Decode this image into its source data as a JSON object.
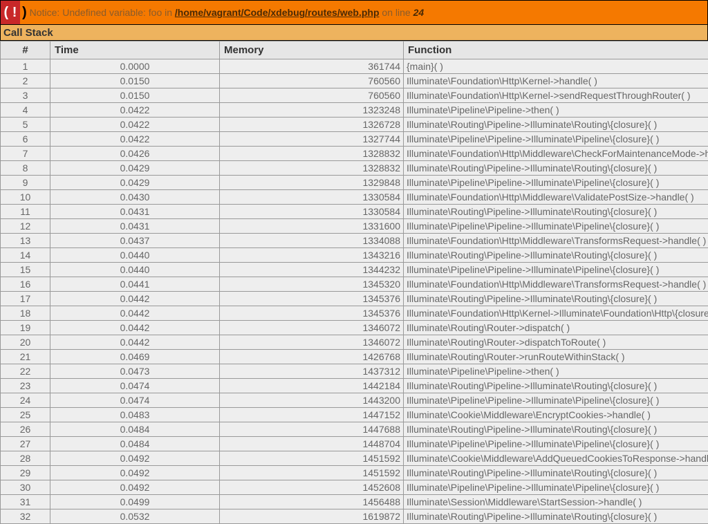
{
  "notice": {
    "label": "Notice:",
    "message": "Undefined variable: foo in",
    "file": "/home/vagrant/Code/xdebug/routes/web.php",
    "on_line_text": "on line",
    "line": "24"
  },
  "callstack": {
    "title": "Call Stack",
    "headers": {
      "num": "#",
      "time": "Time",
      "memory": "Memory",
      "function": "Function"
    },
    "rows": [
      {
        "num": "1",
        "time": "0.0000",
        "memory": "361744",
        "fn": "{main}( )"
      },
      {
        "num": "2",
        "time": "0.0150",
        "memory": "760560",
        "fn": "Illuminate\\Foundation\\Http\\Kernel->handle( )"
      },
      {
        "num": "3",
        "time": "0.0150",
        "memory": "760560",
        "fn": "Illuminate\\Foundation\\Http\\Kernel->sendRequestThroughRouter( )"
      },
      {
        "num": "4",
        "time": "0.0422",
        "memory": "1323248",
        "fn": "Illuminate\\Pipeline\\Pipeline->then( )"
      },
      {
        "num": "5",
        "time": "0.0422",
        "memory": "1326728",
        "fn": "Illuminate\\Routing\\Pipeline->Illuminate\\Routing\\{closure}( )"
      },
      {
        "num": "6",
        "time": "0.0422",
        "memory": "1327744",
        "fn": "Illuminate\\Pipeline\\Pipeline->Illuminate\\Pipeline\\{closure}( )"
      },
      {
        "num": "7",
        "time": "0.0426",
        "memory": "1328832",
        "fn": "Illuminate\\Foundation\\Http\\Middleware\\CheckForMaintenanceMode->handle( )"
      },
      {
        "num": "8",
        "time": "0.0429",
        "memory": "1328832",
        "fn": "Illuminate\\Routing\\Pipeline->Illuminate\\Routing\\{closure}( )"
      },
      {
        "num": "9",
        "time": "0.0429",
        "memory": "1329848",
        "fn": "Illuminate\\Pipeline\\Pipeline->Illuminate\\Pipeline\\{closure}( )"
      },
      {
        "num": "10",
        "time": "0.0430",
        "memory": "1330584",
        "fn": "Illuminate\\Foundation\\Http\\Middleware\\ValidatePostSize->handle( )"
      },
      {
        "num": "11",
        "time": "0.0431",
        "memory": "1330584",
        "fn": "Illuminate\\Routing\\Pipeline->Illuminate\\Routing\\{closure}( )"
      },
      {
        "num": "12",
        "time": "0.0431",
        "memory": "1331600",
        "fn": "Illuminate\\Pipeline\\Pipeline->Illuminate\\Pipeline\\{closure}( )"
      },
      {
        "num": "13",
        "time": "0.0437",
        "memory": "1334088",
        "fn": "Illuminate\\Foundation\\Http\\Middleware\\TransformsRequest->handle( )"
      },
      {
        "num": "14",
        "time": "0.0440",
        "memory": "1343216",
        "fn": "Illuminate\\Routing\\Pipeline->Illuminate\\Routing\\{closure}( )"
      },
      {
        "num": "15",
        "time": "0.0440",
        "memory": "1344232",
        "fn": "Illuminate\\Pipeline\\Pipeline->Illuminate\\Pipeline\\{closure}( )"
      },
      {
        "num": "16",
        "time": "0.0441",
        "memory": "1345320",
        "fn": "Illuminate\\Foundation\\Http\\Middleware\\TransformsRequest->handle( )"
      },
      {
        "num": "17",
        "time": "0.0442",
        "memory": "1345376",
        "fn": "Illuminate\\Routing\\Pipeline->Illuminate\\Routing\\{closure}( )"
      },
      {
        "num": "18",
        "time": "0.0442",
        "memory": "1345376",
        "fn": "Illuminate\\Foundation\\Http\\Kernel->Illuminate\\Foundation\\Http\\{closure}( )"
      },
      {
        "num": "19",
        "time": "0.0442",
        "memory": "1346072",
        "fn": "Illuminate\\Routing\\Router->dispatch( )"
      },
      {
        "num": "20",
        "time": "0.0442",
        "memory": "1346072",
        "fn": "Illuminate\\Routing\\Router->dispatchToRoute( )"
      },
      {
        "num": "21",
        "time": "0.0469",
        "memory": "1426768",
        "fn": "Illuminate\\Routing\\Router->runRouteWithinStack( )"
      },
      {
        "num": "22",
        "time": "0.0473",
        "memory": "1437312",
        "fn": "Illuminate\\Pipeline\\Pipeline->then( )"
      },
      {
        "num": "23",
        "time": "0.0474",
        "memory": "1442184",
        "fn": "Illuminate\\Routing\\Pipeline->Illuminate\\Routing\\{closure}( )"
      },
      {
        "num": "24",
        "time": "0.0474",
        "memory": "1443200",
        "fn": "Illuminate\\Pipeline\\Pipeline->Illuminate\\Pipeline\\{closure}( )"
      },
      {
        "num": "25",
        "time": "0.0483",
        "memory": "1447152",
        "fn": "Illuminate\\Cookie\\Middleware\\EncryptCookies->handle( )"
      },
      {
        "num": "26",
        "time": "0.0484",
        "memory": "1447688",
        "fn": "Illuminate\\Routing\\Pipeline->Illuminate\\Routing\\{closure}( )"
      },
      {
        "num": "27",
        "time": "0.0484",
        "memory": "1448704",
        "fn": "Illuminate\\Pipeline\\Pipeline->Illuminate\\Pipeline\\{closure}( )"
      },
      {
        "num": "28",
        "time": "0.0492",
        "memory": "1451592",
        "fn": "Illuminate\\Cookie\\Middleware\\AddQueuedCookiesToResponse->handle( )"
      },
      {
        "num": "29",
        "time": "0.0492",
        "memory": "1451592",
        "fn": "Illuminate\\Routing\\Pipeline->Illuminate\\Routing\\{closure}( )"
      },
      {
        "num": "30",
        "time": "0.0492",
        "memory": "1452608",
        "fn": "Illuminate\\Pipeline\\Pipeline->Illuminate\\Pipeline\\{closure}( )"
      },
      {
        "num": "31",
        "time": "0.0499",
        "memory": "1456488",
        "fn": "Illuminate\\Session\\Middleware\\StartSession->handle( )"
      },
      {
        "num": "32",
        "time": "0.0532",
        "memory": "1619872",
        "fn": "Illuminate\\Routing\\Pipeline->Illuminate\\Routing\\{closure}( )"
      }
    ]
  }
}
